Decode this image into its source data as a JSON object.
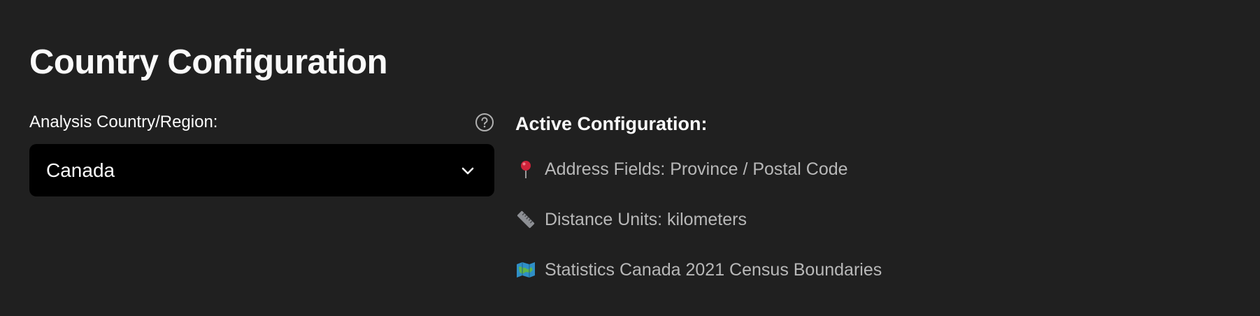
{
  "page": {
    "title": "Country Configuration"
  },
  "country_field": {
    "label": "Analysis Country/Region:",
    "selected_value": "Canada",
    "help_icon": "question-circle-icon",
    "dropdown_icon": "chevron-down-icon"
  },
  "active_config": {
    "heading": "Active Configuration:",
    "items": [
      {
        "icon": "pushpin-icon",
        "text": "Address Fields: Province / Postal Code"
      },
      {
        "icon": "ruler-icon",
        "text": "Distance Units: kilometers"
      },
      {
        "icon": "map-icon",
        "text": "Statistics Canada 2021 Census Boundaries"
      }
    ]
  },
  "colors": {
    "background": "#202020",
    "select_background": "#000000",
    "primary_text": "#fafafa",
    "secondary_text": "#b8b8b8"
  }
}
